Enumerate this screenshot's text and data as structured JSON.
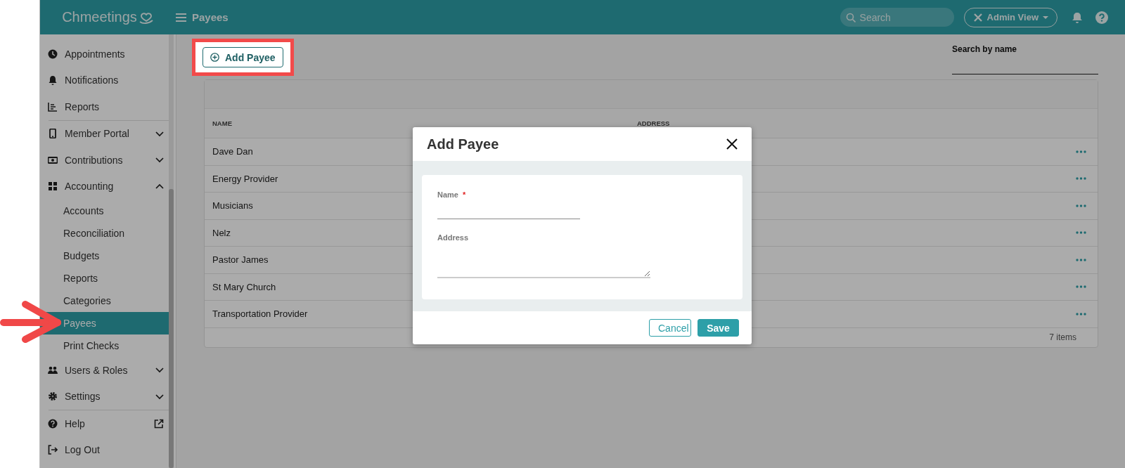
{
  "header": {
    "logo": "Chmeetings",
    "page_title": "Payees",
    "search": {
      "placeholder": "Search"
    },
    "view_button": "Admin View"
  },
  "sidebar": {
    "sections": [
      [
        {
          "label": "Appointments",
          "kind": "link",
          "selected": false
        },
        {
          "label": "Notifications",
          "kind": "link",
          "selected": false
        },
        {
          "label": "Reports",
          "kind": "link",
          "selected": false
        }
      ],
      [
        {
          "label": "Member Portal",
          "kind": "group",
          "expanded": false,
          "selected": false
        },
        {
          "label": "Contributions",
          "kind": "group",
          "expanded": false,
          "selected": false
        },
        {
          "label": "Accounting",
          "kind": "group",
          "expanded": true,
          "selected": false,
          "children": [
            {
              "label": "Accounts",
              "selected": false
            },
            {
              "label": "Reconciliation",
              "selected": false
            },
            {
              "label": "Budgets",
              "selected": false
            },
            {
              "label": "Reports",
              "selected": false
            },
            {
              "label": "Categories",
              "selected": false
            },
            {
              "label": "Payees",
              "selected": true
            },
            {
              "label": "Print Checks",
              "selected": false
            }
          ]
        },
        {
          "label": "Users & Roles",
          "kind": "group",
          "expanded": false,
          "selected": false
        },
        {
          "label": "Settings",
          "kind": "group",
          "expanded": false,
          "selected": false
        }
      ],
      [
        {
          "label": "Help",
          "kind": "external",
          "selected": false
        },
        {
          "label": "Log Out",
          "kind": "link",
          "selected": false
        }
      ]
    ]
  },
  "toolbar": {
    "add_button": "Add Payee",
    "search": {
      "label": "Search by name"
    }
  },
  "table": {
    "columns": [
      "NAME",
      "ADDRESS"
    ],
    "rows": [
      {
        "name": "Dave Dan"
      },
      {
        "name": "Energy Provider"
      },
      {
        "name": "Musicians"
      },
      {
        "name": "Nelz"
      },
      {
        "name": "Pastor James"
      },
      {
        "name": "St Mary Church"
      },
      {
        "name": "Transportation Provider"
      }
    ],
    "footer": "7 items"
  },
  "dialog": {
    "title": "Add Payee",
    "required_marker": "*",
    "fields": [
      {
        "label": "Name",
        "required": true,
        "kind": "input"
      },
      {
        "label": "Address",
        "required": false,
        "kind": "textarea"
      }
    ],
    "buttons": [
      {
        "label": "Cancel",
        "kind": "secondary"
      },
      {
        "label": "Save",
        "kind": "primary"
      }
    ]
  }
}
